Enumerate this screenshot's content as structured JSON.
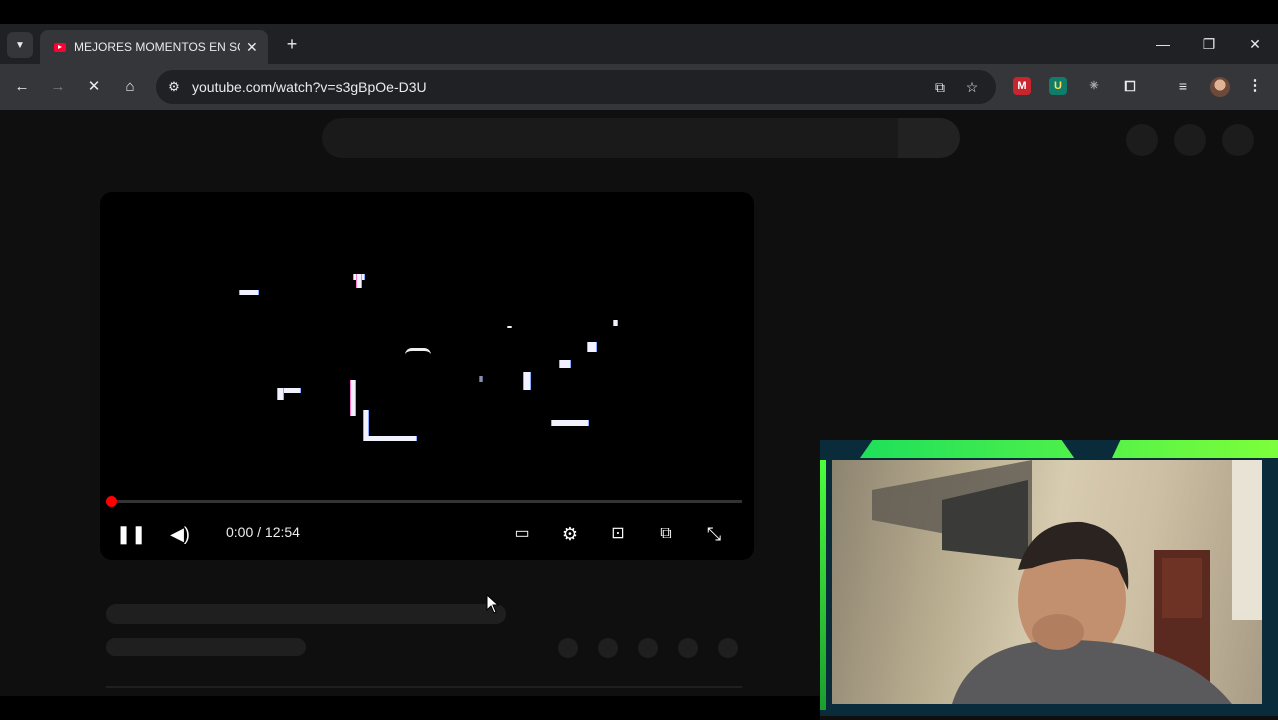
{
  "browser": {
    "tab_title": "MEJORES MOMENTOS EN SQU",
    "tab_close": "✕",
    "new_tab": "+",
    "url": "youtube.com/watch?v=s3gBpOe-D3U",
    "window_controls": {
      "minimize": "—",
      "restore": "❐",
      "close": "✕"
    }
  },
  "player": {
    "time": "0:00 / 12:54",
    "progress_fraction": 0.0,
    "state": "playing"
  },
  "colors": {
    "progress": "#ff0000",
    "webcam_frame": "#39ff3a",
    "page_bg": "#0f0f0f"
  },
  "icons": [
    "tab-list-icon",
    "youtube-favicon",
    "back-icon",
    "forward-icon",
    "stop-loading-icon",
    "home-icon",
    "site-info-icon",
    "install-app-icon",
    "bookmark-star-icon",
    "extensions-icon",
    "media-icon",
    "menu-icon",
    "pause-icon",
    "volume-icon",
    "subtitles-icon",
    "settings-icon",
    "theater-icon",
    "cast-icon",
    "fullscreen-icon",
    "cursor-arrow"
  ]
}
